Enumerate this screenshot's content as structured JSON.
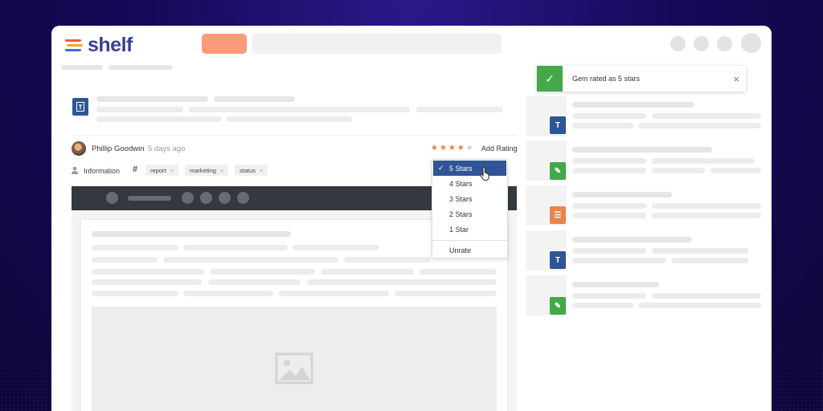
{
  "app": {
    "logo_text": "shelf"
  },
  "post": {
    "author": "Phillip Goodwin",
    "time": "5 days ago",
    "add_rating_label": "Add Rating",
    "rating": {
      "value": 4,
      "max": 5
    },
    "info_label": "Information",
    "tags": [
      "report",
      "marketing",
      "status"
    ],
    "tag_remove_glyph": "×"
  },
  "rating_menu": {
    "options": [
      "5 Stars",
      "4 Stars",
      "3 Stars",
      "2 Stars",
      "1 Star"
    ],
    "selected": "5 Stars",
    "unrate_label": "Unrate"
  },
  "toast": {
    "message": "Gem rated as 5 stars",
    "close_glyph": "×"
  },
  "colors": {
    "accent": "#2f5597",
    "success": "#45a84b",
    "star": "#f07a3a",
    "orange_button": "#fb9b77"
  },
  "icons": [
    "shelf-logo-icon",
    "document-icon",
    "hashtag-icon",
    "person-icon",
    "check-icon",
    "close-icon",
    "image-placeholder-icon",
    "hand-pointer-icon",
    "star-icon",
    "chat-icon"
  ]
}
